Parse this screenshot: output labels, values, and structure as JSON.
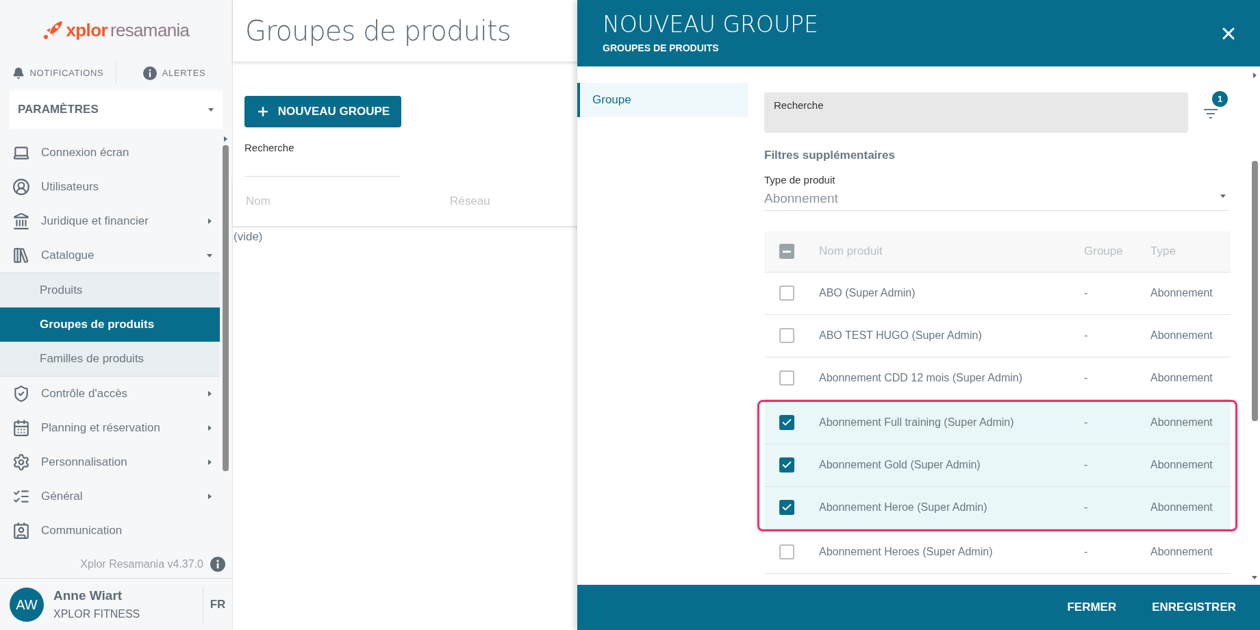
{
  "sidebar": {
    "logo": {
      "brand": "xplor",
      "product": "resamania"
    },
    "notifications": "NOTIFICATIONS",
    "alerts": "ALERTES",
    "section": "PARAMÈTRES",
    "items": [
      {
        "label": "Connexion écran",
        "kind": "screen"
      },
      {
        "label": "Utilisateurs",
        "kind": "user"
      },
      {
        "label": "Juridique et financier",
        "kind": "bank",
        "expanded": false
      },
      {
        "label": "Catalogue",
        "kind": "catalog",
        "expanded": true,
        "children": [
          {
            "label": "Produits",
            "selected": false
          },
          {
            "label": "Groupes de produits",
            "selected": true
          },
          {
            "label": "Familles de produits",
            "selected": false
          }
        ]
      },
      {
        "label": "Contrôle d'accès",
        "kind": "shield",
        "expanded": false
      },
      {
        "label": "Planning et réservation",
        "kind": "calendar",
        "expanded": false
      },
      {
        "label": "Personnalisation",
        "kind": "gear",
        "expanded": false
      },
      {
        "label": "Général",
        "kind": "list",
        "expanded": false
      },
      {
        "label": "Communication",
        "kind": "contact"
      }
    ],
    "version": "Xplor Resamania v4.37.0",
    "user": {
      "initials": "AW",
      "name": "Anne Wiart",
      "company": "XPLOR FITNESS"
    },
    "language": "FR"
  },
  "page": {
    "title": "Groupes de produits",
    "new_button": "NOUVEAU GROUPE",
    "search_label": "Recherche",
    "columns": [
      "Nom",
      "Réseau"
    ],
    "empty": "(vide)"
  },
  "drawer": {
    "title": "NOUVEAU GROUPE",
    "subtitle": "GROUPES DE PRODUITS",
    "nav": [
      {
        "label": "Groupe",
        "selected": true
      }
    ],
    "search_label": "Recherche",
    "filter_count": "1",
    "filters_title": "Filtres supplémentaires",
    "type_field": {
      "label": "Type de produit",
      "value": "Abonnement"
    },
    "table": {
      "select_all": {
        "checked": true,
        "partial": true
      },
      "columns": [
        "Nom produit",
        "Groupe",
        "Type"
      ],
      "rows": [
        {
          "name": "ABO (Super Admin)",
          "group": "-",
          "type": "Abonnement",
          "checked": false,
          "highlighted": false
        },
        {
          "name": "ABO TEST HUGO (Super Admin)",
          "group": "-",
          "type": "Abonnement",
          "checked": false,
          "highlighted": false
        },
        {
          "name": "Abonnement CDD 12 mois (Super Admin)",
          "group": "-",
          "type": "Abonnement",
          "checked": false,
          "highlighted": false
        },
        {
          "name": "Abonnement Full training (Super Admin)",
          "group": "-",
          "type": "Abonnement",
          "checked": true,
          "highlighted": true
        },
        {
          "name": "Abonnement Gold (Super Admin)",
          "group": "-",
          "type": "Abonnement",
          "checked": true,
          "highlighted": true
        },
        {
          "name": "Abonnement Heroe (Super Admin)",
          "group": "-",
          "type": "Abonnement",
          "checked": true,
          "highlighted": true
        },
        {
          "name": "Abonnement Heroes (Super Admin)",
          "group": "-",
          "type": "Abonnement",
          "checked": false,
          "highlighted": false
        }
      ]
    },
    "buttons": [
      "FERMER",
      "ENREGISTRER"
    ]
  }
}
